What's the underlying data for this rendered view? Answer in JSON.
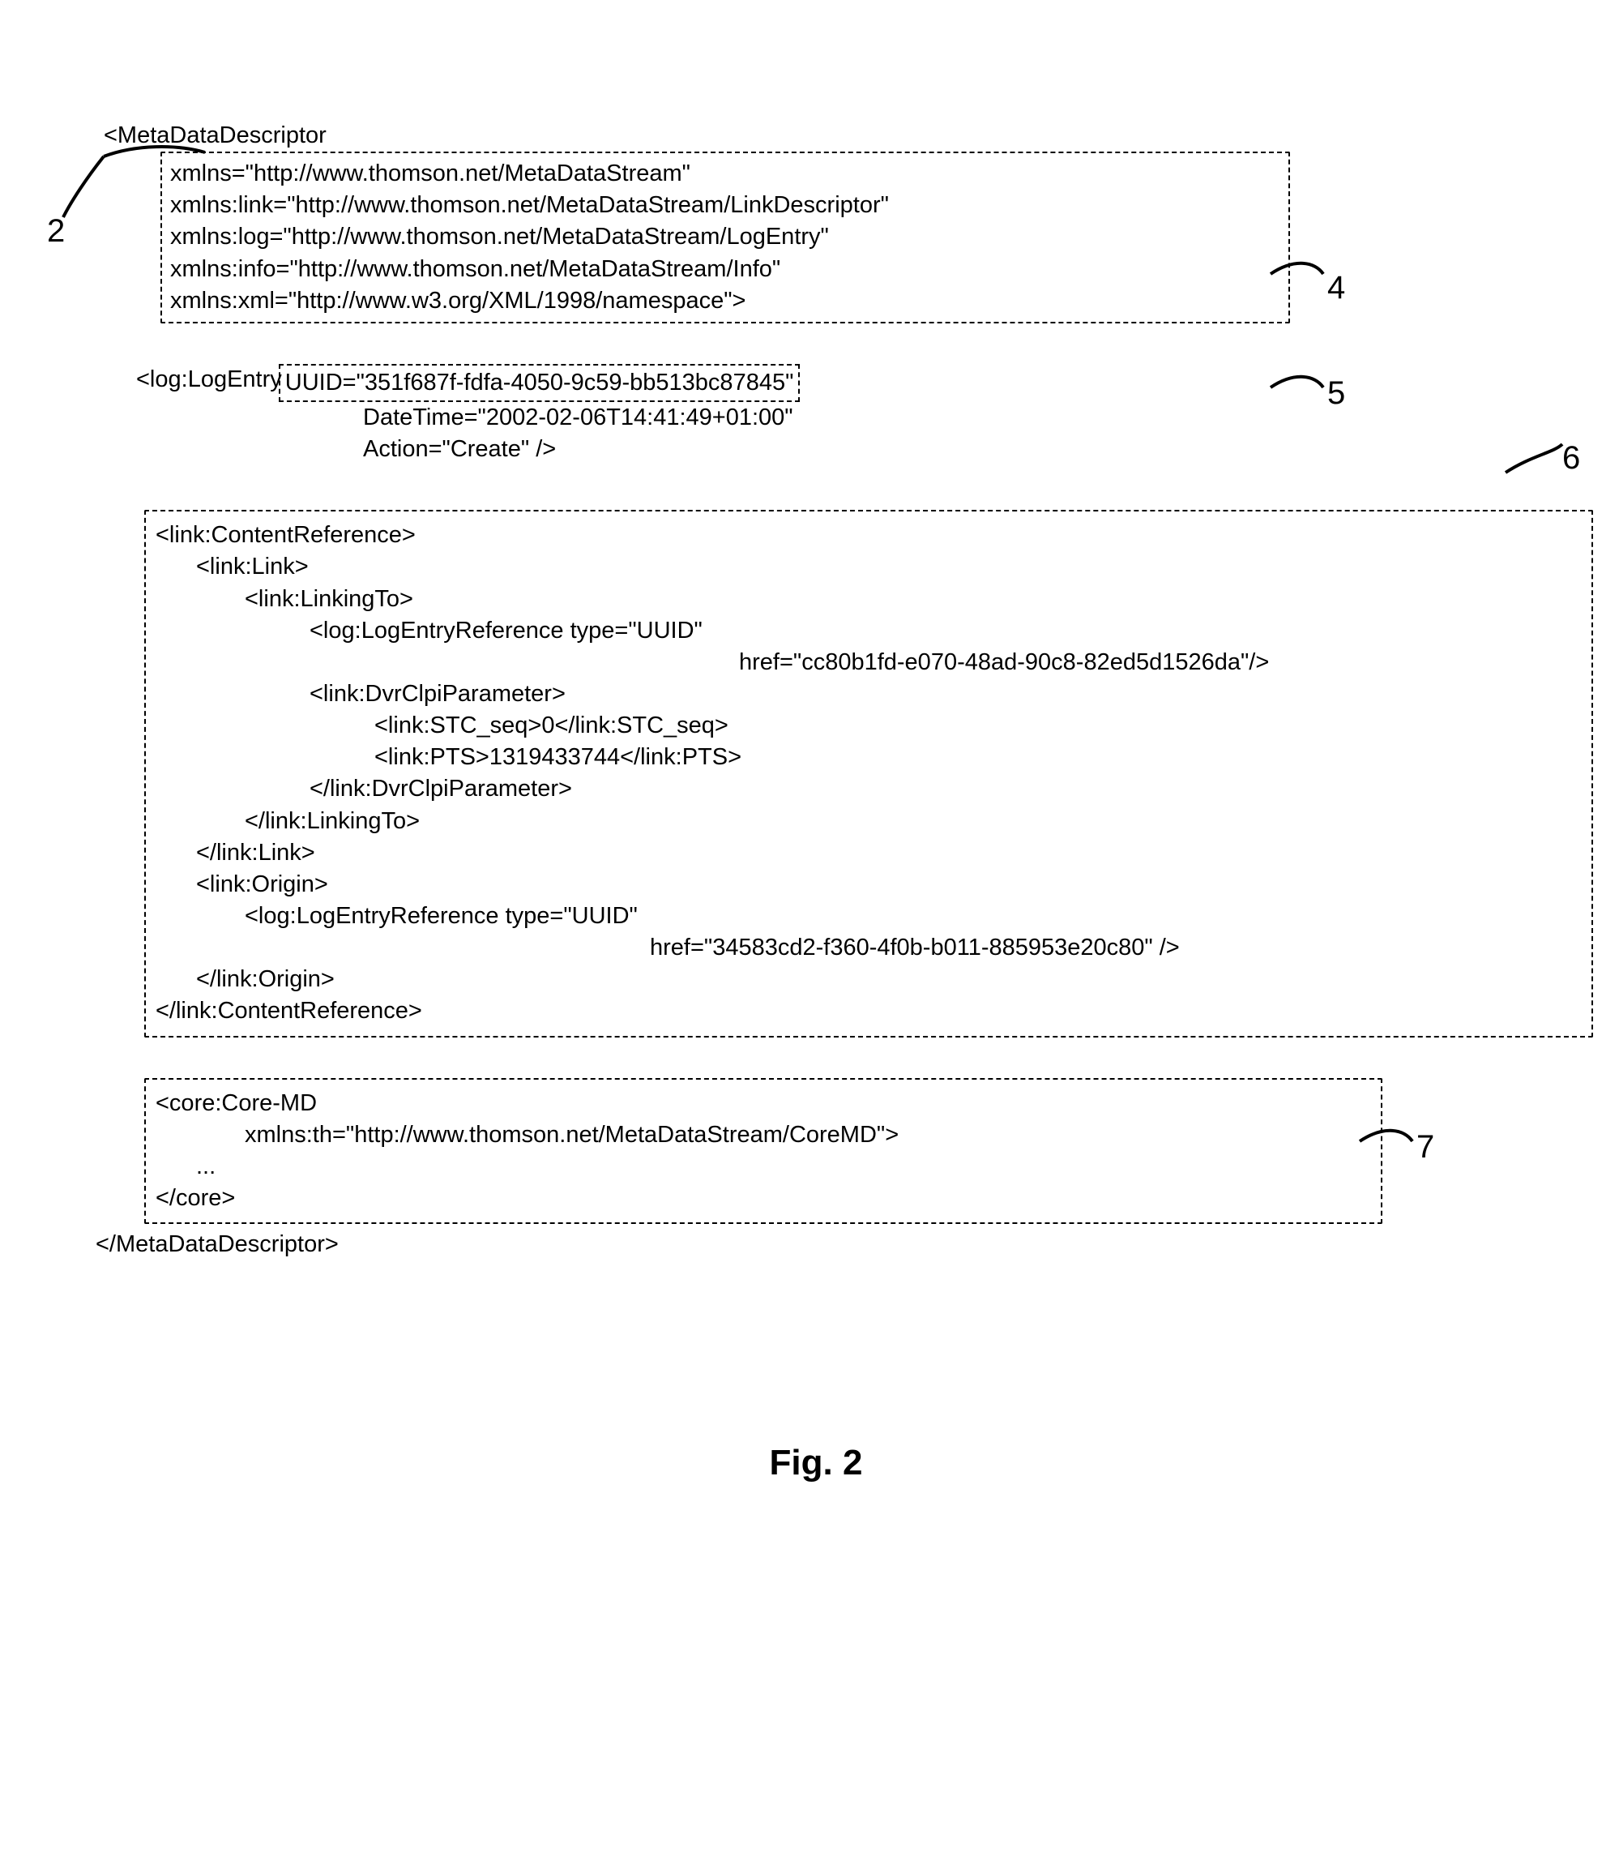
{
  "root_open": "<MetaDataDescriptor",
  "ns": {
    "l1": "xmlns=\"http://www.thomson.net/MetaDataStream\"",
    "l2": "xmlns:link=\"http://www.thomson.net/MetaDataStream/LinkDescriptor\"",
    "l3": "xmlns:log=\"http://www.thomson.net/MetaDataStream/LogEntry\"",
    "l4": "xmlns:info=\"http://www.thomson.net/MetaDataStream/Info\"",
    "l5": "xmlns:xml=\"http://www.w3.org/XML/1998/namespace\">"
  },
  "log": {
    "open": "<log:LogEntry",
    "uuid_attr": "UUID=\"351f687f-fdfa-4050-9c59-bb513bc87845\"",
    "datetime": "DateTime=\"2002-02-06T14:41:49+01:00\"",
    "action": "Action=\"Create\" />"
  },
  "cr": {
    "open": "<link:ContentReference>",
    "link_open": "<link:Link>",
    "linkingto_open": "<link:LinkingTo>",
    "ler1_a": "<log:LogEntryReference type=\"UUID\"",
    "ler1_b": "href=\"cc80b1fd-e070-48ad-90c8-82ed5d1526da\"/>",
    "dvr_open": "<link:DvrClpiParameter>",
    "stc": "<link:STC_seq>0</link:STC_seq>",
    "pts": "<link:PTS>1319433744</link:PTS>",
    "dvr_close": "</link:DvrClpiParameter>",
    "linkingto_close": "</link:LinkingTo>",
    "link_close": "</link:Link>",
    "origin_open": "<link:Origin>",
    "ler2_a": "<log:LogEntryReference type=\"UUID\"",
    "ler2_b": "href=\"34583cd2-f360-4f0b-b011-885953e20c80\" />",
    "origin_close": "</link:Origin>",
    "close": "</link:ContentReference>"
  },
  "core": {
    "open": "<core:Core-MD",
    "ns": "xmlns:th=\"http://www.thomson.net/MetaDataStream/CoreMD\">",
    "ellipsis": "...",
    "close": "</core>"
  },
  "root_close": "</MetaDataDescriptor>",
  "labels": {
    "n2": "2",
    "n4": "4",
    "n5": "5",
    "n6": "6",
    "n7": "7"
  },
  "figure": "Fig. 2"
}
